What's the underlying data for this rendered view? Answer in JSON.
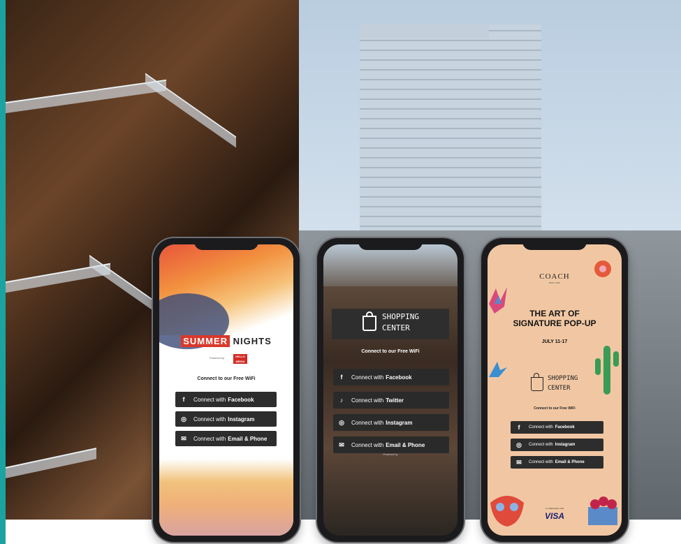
{
  "colors": {
    "teal_edge": "#1aa3a1",
    "button_dark": "#2d2d2d",
    "summer_red": "#d9392b",
    "coach_background": "#f1c7a3",
    "visa_blue": "#1a1f71"
  },
  "phone1": {
    "brand_highlight": "SUMMER",
    "brand_rest": "NIGHTS",
    "powered_by": "Powered by",
    "sponsor_logo": "HELLO MEDIA",
    "connect_heading": "Connect to our Free WiFi",
    "buttons": [
      {
        "icon": "facebook-icon",
        "prefix": "Connect with",
        "label": "Facebook"
      },
      {
        "icon": "instagram-icon",
        "prefix": "Connect with",
        "label": "Instagram"
      },
      {
        "icon": "email-icon",
        "prefix": "Connect with",
        "label": "Email & Phone"
      }
    ]
  },
  "phone2": {
    "logo_line1": "SHOPPING",
    "logo_line2": "CENTER",
    "connect_heading": "Connect to our Free WiFi",
    "buttons": [
      {
        "icon": "facebook-icon",
        "prefix": "Connect with",
        "label": "Facebook"
      },
      {
        "icon": "twitter-icon",
        "prefix": "Connect with",
        "label": "Twitter"
      },
      {
        "icon": "instagram-icon",
        "prefix": "Connect with",
        "label": "Instagram"
      },
      {
        "icon": "email-icon",
        "prefix": "Connect with",
        "label": "Email & Phone"
      }
    ],
    "powered_by": "Powered by"
  },
  "phone3": {
    "brand": "COACH",
    "brand_sub": "NEW YORK",
    "title_line1": "THE ART OF",
    "title_line2": "SIGNATURE POP-UP",
    "date": "JULY 11-17",
    "logo_line1": "SHOPPING",
    "logo_line2": "CENTER",
    "connect_heading": "Connect to our Free WiFi",
    "buttons": [
      {
        "icon": "facebook-icon",
        "prefix": "Connect with",
        "label": "Facebook"
      },
      {
        "icon": "instagram-icon",
        "prefix": "Connect with",
        "label": "Instagram"
      },
      {
        "icon": "email-icon",
        "prefix": "Connect with",
        "label": "Email & Phone"
      }
    ],
    "collab_text": "In collaboration with",
    "sponsor": "VISA"
  }
}
